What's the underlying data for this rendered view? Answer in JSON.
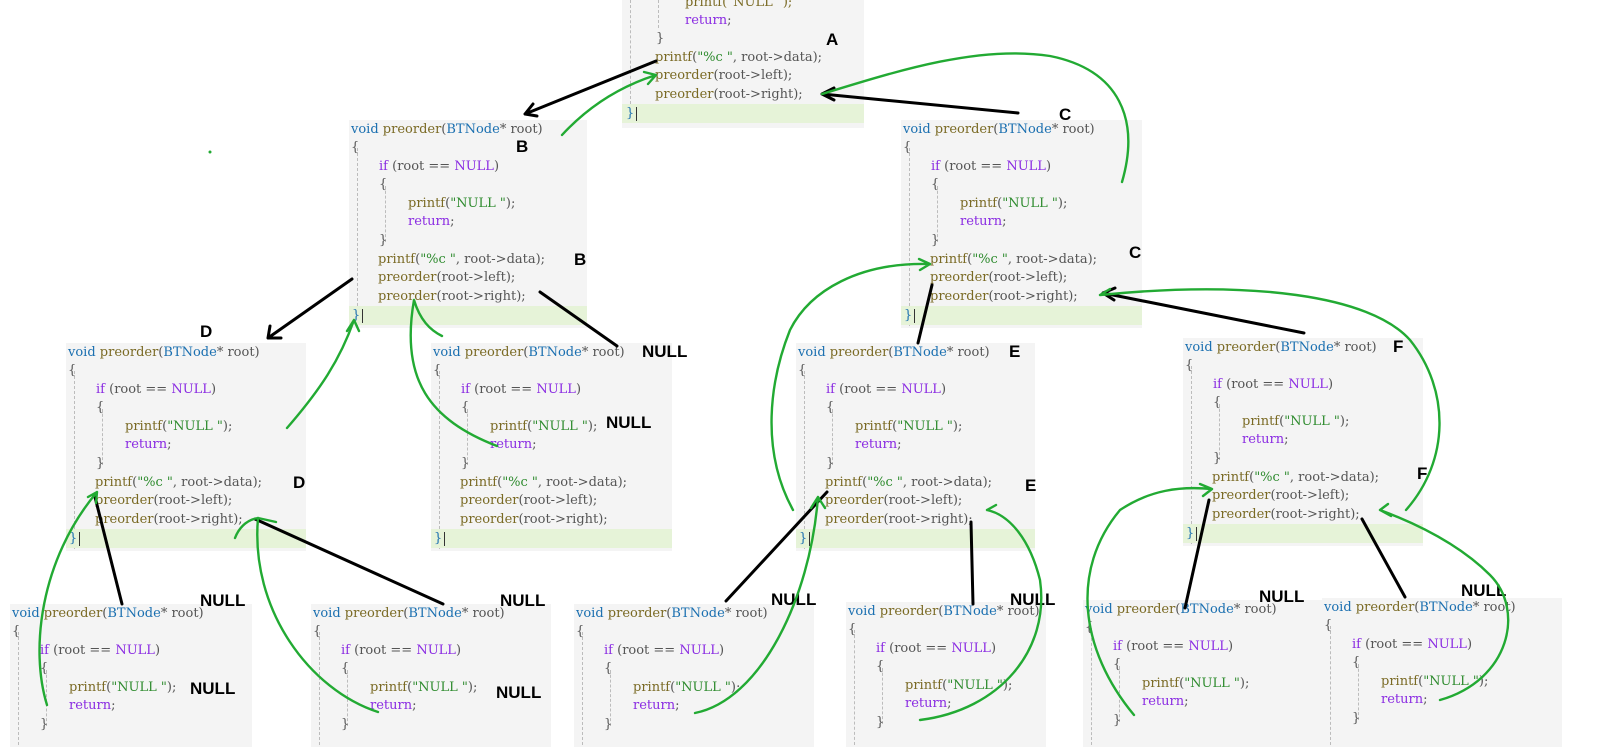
{
  "code": {
    "signature_void": "void",
    "signature_name": "preorder",
    "signature_type": "BTNode",
    "signature_rest": "* root)",
    "open_brace": "{",
    "close_brace": "}",
    "if_kw": "if",
    "if_cond_open": " (root == ",
    "null_kw": "NULL",
    "if_cond_close": ")",
    "printf_fn": "printf",
    "printf_null_open": "(",
    "printf_null_str": "\"NULL \"",
    "printf_null_close": ");",
    "return_kw": "return",
    "semicolon": ";",
    "printf_data_fmt": "\"%c \"",
    "printf_data_rest": ", root->data);",
    "left_call_fn": "preorder",
    "left_call_rest": "(root->left);",
    "right_call_fn": "preorder",
    "right_call_rest": "(root->right);",
    "top_fragment": "printf(\"NULL \");"
  },
  "labels": {
    "A": "A",
    "B": "B",
    "C": "C",
    "D": "D",
    "E": "E",
    "F": "F",
    "NULL": "NULL"
  },
  "colors": {
    "arrow_black": "#000000",
    "arrow_green": "#22aa33",
    "code_bg": "#f4f4f4",
    "highlight_line": "#e6f3d8"
  }
}
